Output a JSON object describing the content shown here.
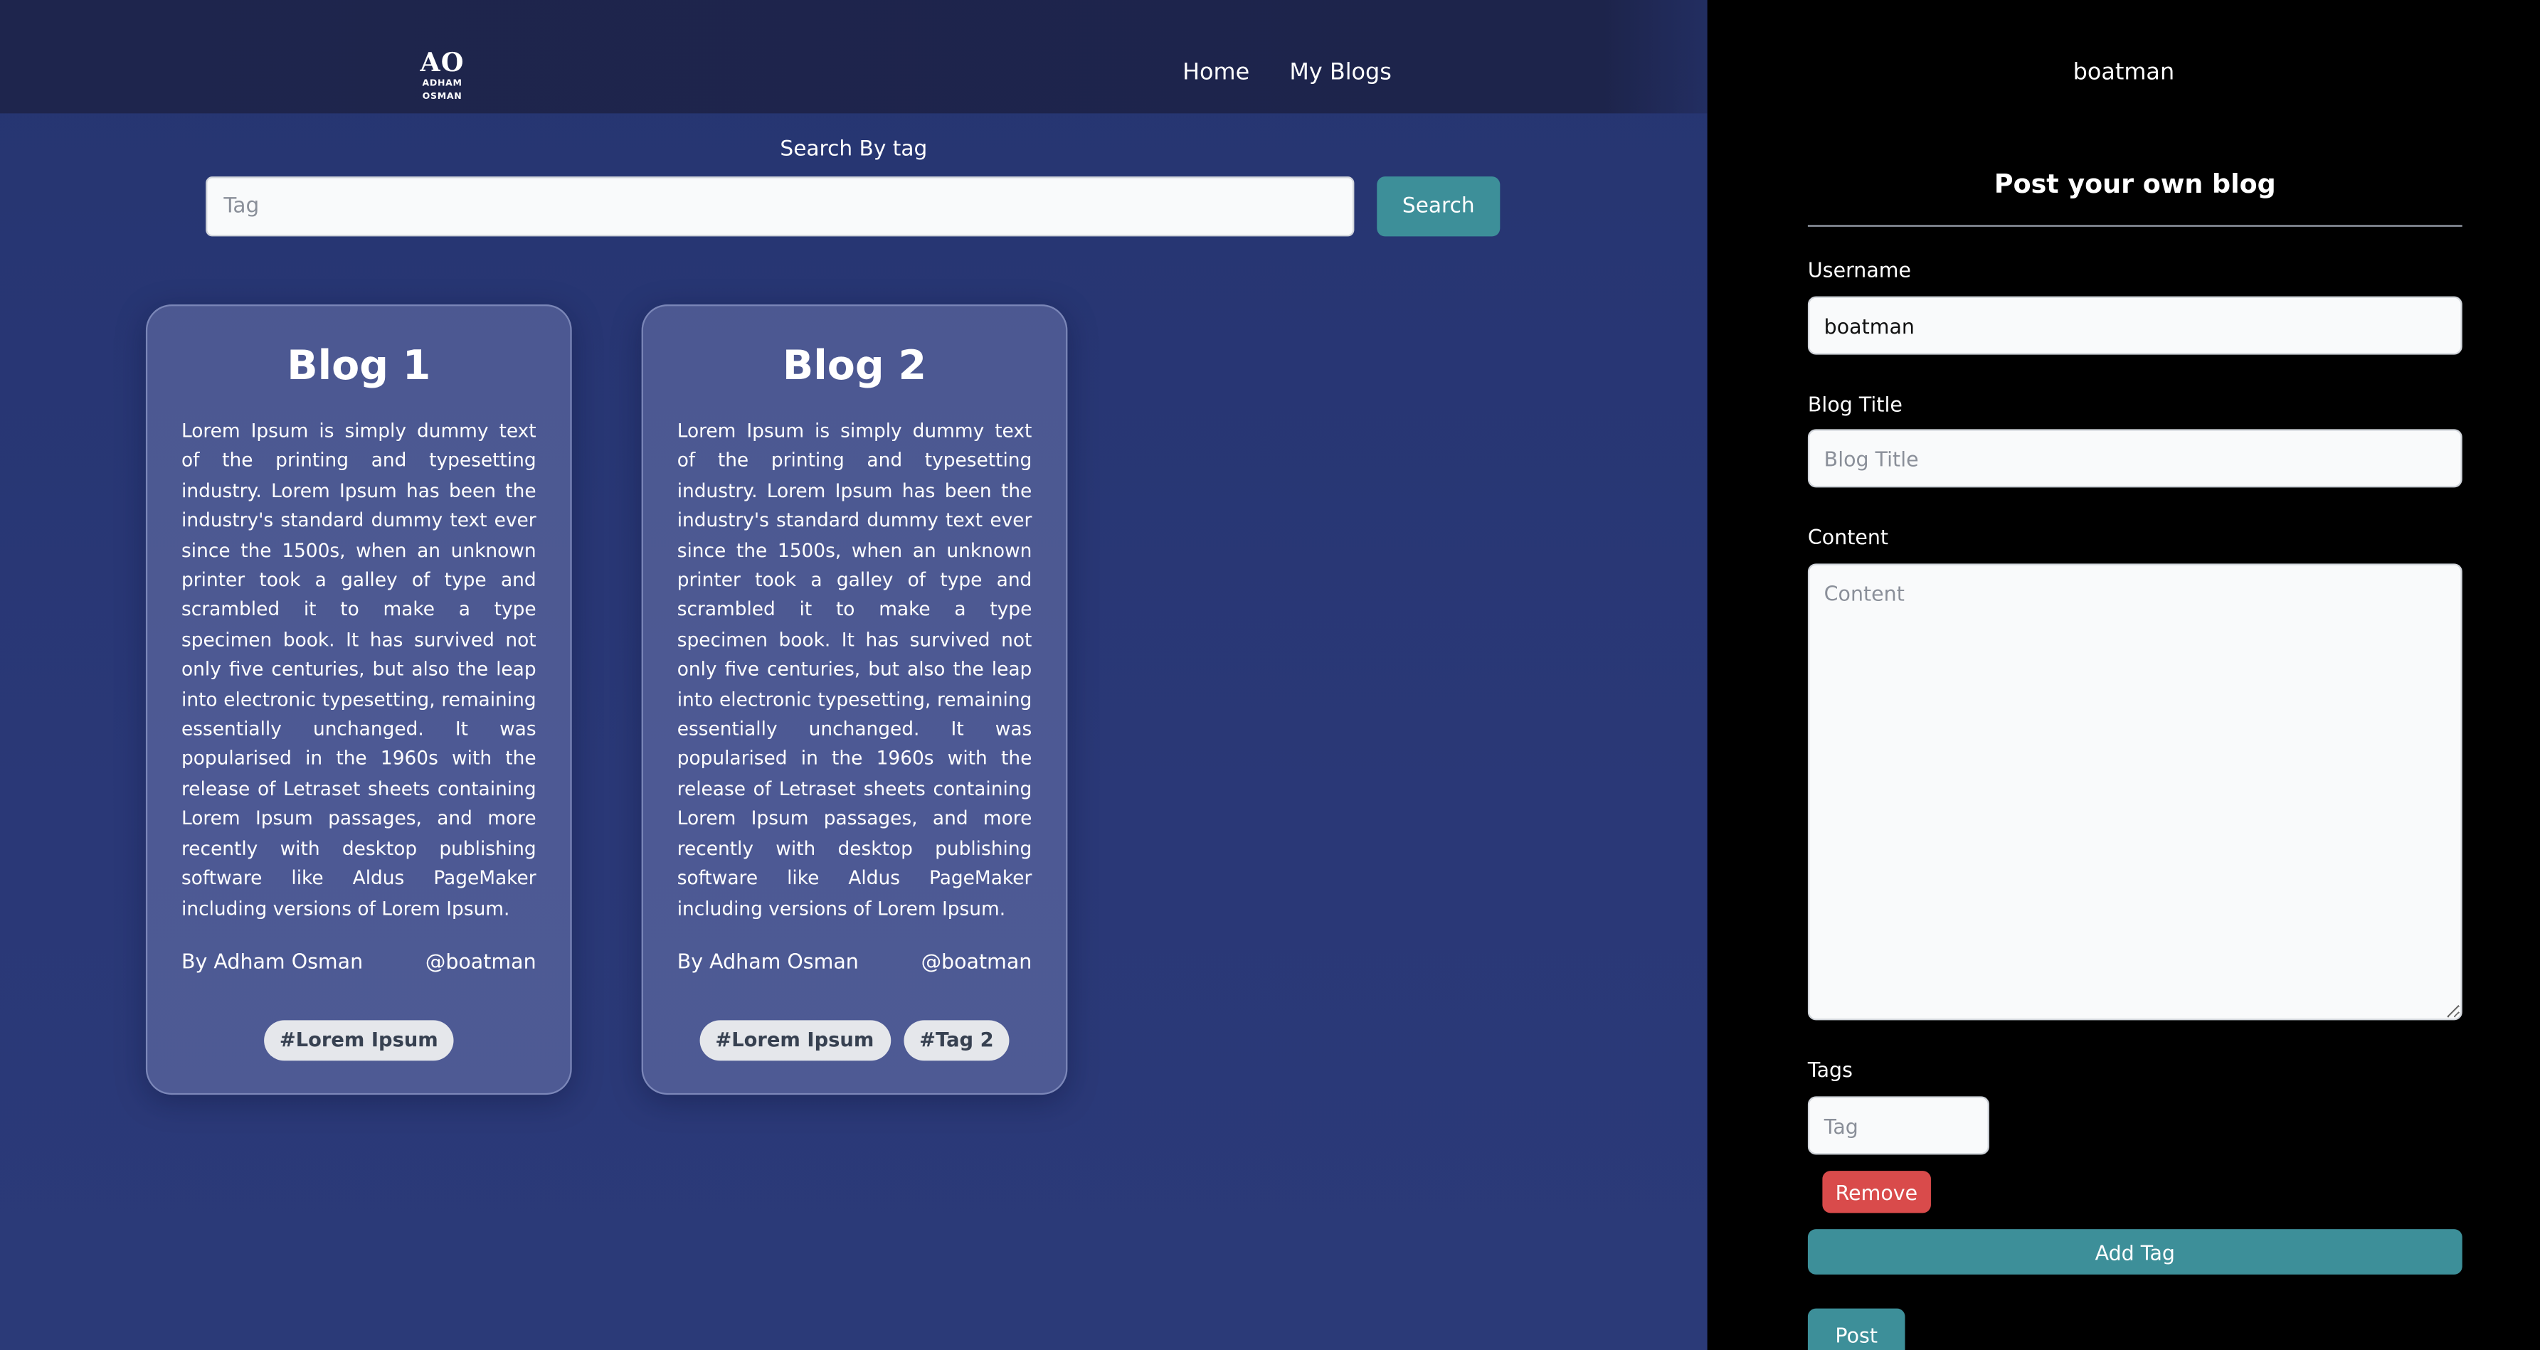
{
  "nav": {
    "logo_mark": "AO",
    "logo_name": "ADHAM OSMAN",
    "links": [
      {
        "label": "Home"
      },
      {
        "label": "My Blogs"
      }
    ]
  },
  "search": {
    "label": "Search By tag",
    "placeholder": "Tag",
    "button_label": "Search"
  },
  "blogs": [
    {
      "title": "Blog 1",
      "content": "Lorem Ipsum is simply dummy text of the printing and typesetting industry. Lorem Ipsum has been the industry's standard dummy text ever since the 1500s, when an unknown printer took a galley of type and scrambled it to make a type specimen book. It has survived not only five centuries, but also the leap into electronic typesetting, remaining essentially unchanged. It was popularised in the 1960s with the release of Letraset sheets containing Lorem Ipsum passages, and more recently with desktop publishing software like Aldus PageMaker including versions of Lorem Ipsum.",
      "author": "By Adham Osman",
      "handle": "@boatman",
      "tags": [
        "#Lorem Ipsum"
      ]
    },
    {
      "title": "Blog 2",
      "content": "Lorem Ipsum is simply dummy text of the printing and typesetting industry. Lorem Ipsum has been the industry's standard dummy text ever since the 1500s, when an unknown printer took a galley of type and scrambled it to make a type specimen book. It has survived not only five centuries, but also the leap into electronic typesetting, remaining essentially unchanged. It was popularised in the 1960s with the release of Letraset sheets containing Lorem Ipsum passages, and more recently with desktop publishing software like Aldus PageMaker including versions of Lorem Ipsum.",
      "author": "By Adham Osman",
      "handle": "@boatman",
      "tags": [
        "#Lorem Ipsum",
        "#Tag 2"
      ]
    }
  ],
  "panel": {
    "current_user": "boatman",
    "title": "Post your own blog",
    "username_label": "Username",
    "username_value": "boatman",
    "blog_title_label": "Blog Title",
    "blog_title_placeholder": "Blog Title",
    "content_label": "Content",
    "content_placeholder": "Content",
    "tags_label": "Tags",
    "tag_placeholder": "Tag",
    "remove_label": "Remove",
    "add_tag_label": "Add Tag",
    "post_label": "Post"
  },
  "colors": {
    "accent": "#3d8f99",
    "danger": "#d94b4b",
    "background": "#283675",
    "navbar": "#1e254d",
    "panel": "#000000"
  }
}
